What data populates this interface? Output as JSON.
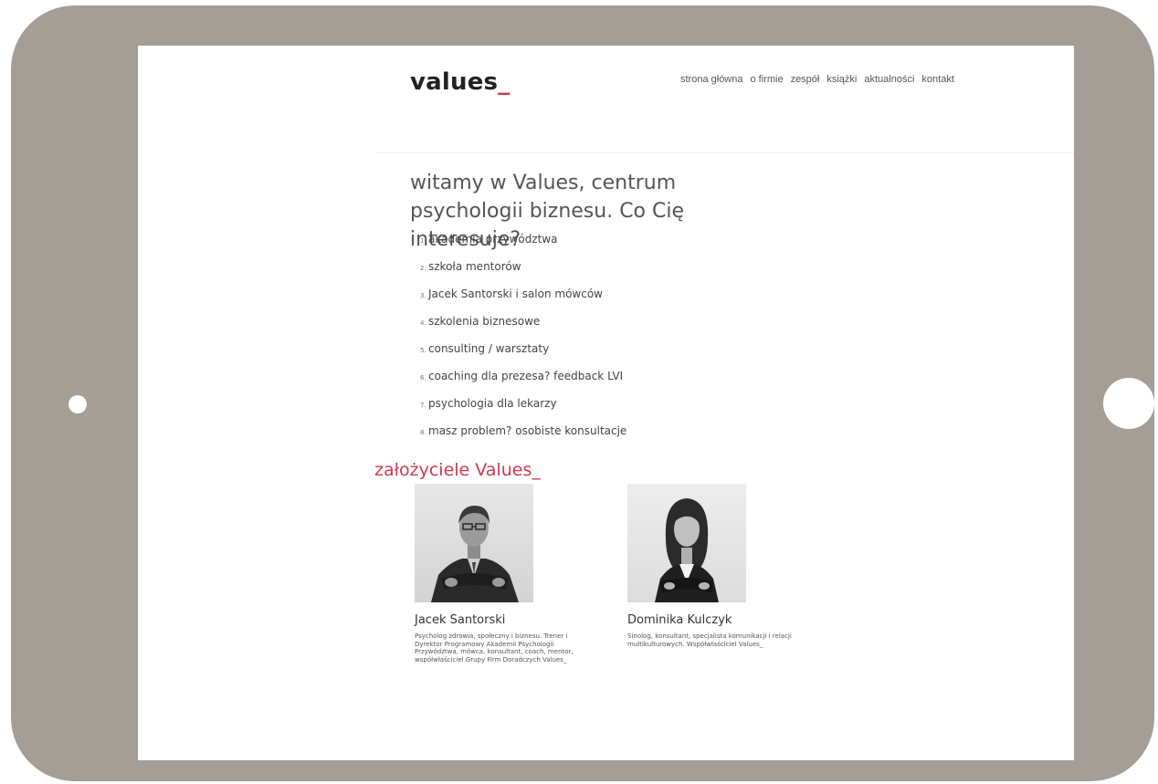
{
  "brand": {
    "logo_text": "values",
    "logo_underscore": "_"
  },
  "nav": {
    "items": [
      "strona główna",
      "o firmie",
      "zespół",
      "książki",
      "aktualności",
      "kontakt"
    ]
  },
  "intro": {
    "headline": "witamy w Values, centrum psychologii biznesu. Co Cię interesuje?"
  },
  "menu": {
    "items": [
      {
        "num": "1.",
        "label": "akademia przywództwa"
      },
      {
        "num": "2.",
        "label": "szkoła mentorów"
      },
      {
        "num": "3.",
        "label": "Jacek Santorski i salon mówców"
      },
      {
        "num": "4.",
        "label": "szkolenia biznesowe"
      },
      {
        "num": "5.",
        "label": "consulting / warsztaty"
      },
      {
        "num": "6.",
        "label": "coaching dla prezesa? feedback LVI"
      },
      {
        "num": "7.",
        "label": "psychologia dla lekarzy"
      },
      {
        "num": "8.",
        "label": "masz problem? osobiste konsultacje"
      }
    ]
  },
  "founders": {
    "title": "założyciele Values_",
    "people": [
      {
        "name": "Jacek Santorski",
        "bio": "Psycholog zdrowia, społeczny i biznesu. Trener i Dyrektor Programowy Akademii Psychologii Przywództwa, mówca, konsultant, coach, mentor, współwłaściciel Grupy Firm Doradczych Values_"
      },
      {
        "name": "Dominika Kulczyk",
        "bio": "Sinolog, konsultant, specjalista komunikacji i relacji multikulturowych. Współwłaściciel Values_"
      }
    ]
  },
  "colors": {
    "accent": "#d1374a",
    "frame": "#a49e97"
  }
}
